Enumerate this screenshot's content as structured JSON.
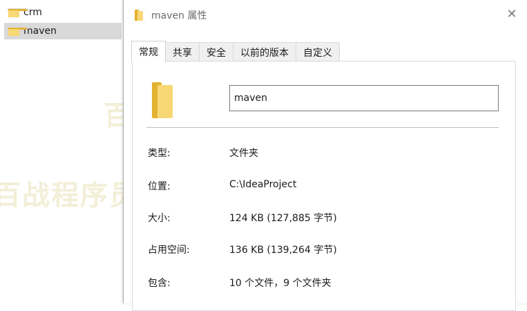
{
  "explorer": {
    "items": [
      {
        "label": "crm",
        "selected": false
      },
      {
        "label": "maven",
        "selected": true
      }
    ]
  },
  "dialog": {
    "title": "maven 属性",
    "close_glyph": "✕",
    "tabs": [
      "常规",
      "共享",
      "安全",
      "以前的版本",
      "自定义"
    ],
    "active_tab": "常规",
    "name_value": "maven",
    "properties": [
      {
        "label": "类型:",
        "value": "文件夹"
      },
      {
        "label": "位置:",
        "value": "C:\\IdeaProject"
      },
      {
        "label": "大小:",
        "value": "124 KB (127,885 字节)"
      },
      {
        "label": "占用空间:",
        "value": "136 KB (139,264 字节)"
      },
      {
        "label": "包含:",
        "value": "10 个文件，9 个文件夹"
      }
    ]
  },
  "watermark": "百战程序员",
  "colors": {
    "folder_front": "#f8d775",
    "folder_back": "#e3b232",
    "selection": "#d9d9d9",
    "watermark": "#f3efd8"
  }
}
